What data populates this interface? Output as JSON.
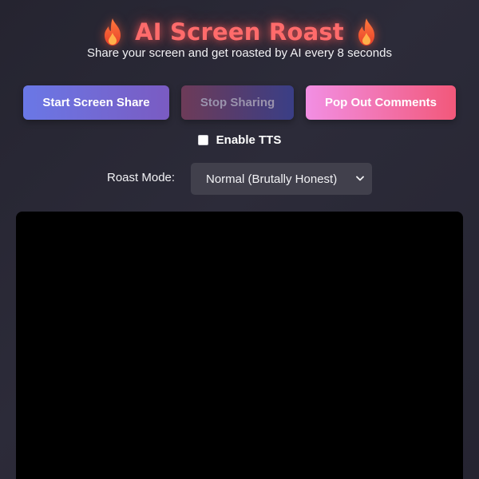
{
  "header": {
    "title": "AI Screen Roast",
    "subtitle": "Share your screen and get roasted by AI every 8 seconds",
    "title_icon": "fire-icon"
  },
  "toolbar": {
    "start_label": "Start Screen Share",
    "stop_label": "Stop Sharing",
    "popout_label": "Pop Out Comments"
  },
  "tts": {
    "label": "Enable TTS",
    "checked": false
  },
  "roast_mode": {
    "label": "Roast Mode:",
    "selected": "Normal (Brutally Honest)"
  },
  "colors": {
    "title": "#ff6b6b",
    "background": "#2a2936",
    "start_button": "#6a78e6",
    "popout_button": "#f2587a",
    "video_area": "#000000"
  }
}
